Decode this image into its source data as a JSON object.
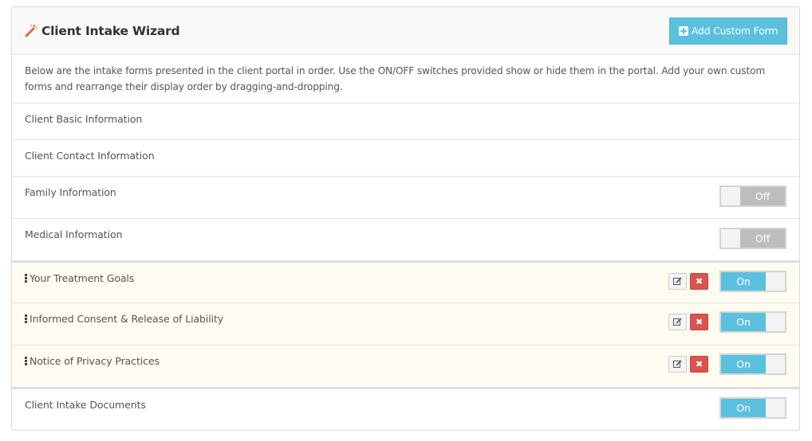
{
  "header": {
    "title": "Client Intake Wizard",
    "title_icon": "magic-wand-icon",
    "add_button_label": "Add Custom Form",
    "add_button_icon": "plus-square-icon"
  },
  "intro_text": "Below are the intake forms presented in the client portal in order. Use the ON/OFF switches provided show or hide them in the portal. Add your own custom forms and rearrange their display order by dragging-and-dropping.",
  "colors": {
    "accent": "#5bc0de",
    "danger": "#d9534f",
    "toggle_off": "#bdbdbd",
    "custom_row_bg": "#fefcf0",
    "wand": "#f0643c"
  },
  "forms": [
    {
      "label": "Client Basic Information"
    },
    {
      "label": "Client Contact Information"
    },
    {
      "label": "Family Information",
      "toggle": "Off"
    },
    {
      "label": "Medical Information",
      "toggle": "Off"
    },
    {
      "label": "Your Treatment Goals",
      "toggle": "On",
      "custom": true
    },
    {
      "label": "Informed Consent & Release of Liability",
      "toggle": "On",
      "custom": true
    },
    {
      "label": "Notice of Privacy Practices",
      "toggle": "On",
      "custom": true
    },
    {
      "label": "Client Intake Documents",
      "toggle": "On"
    }
  ],
  "delete_icon_glyph": "✖"
}
